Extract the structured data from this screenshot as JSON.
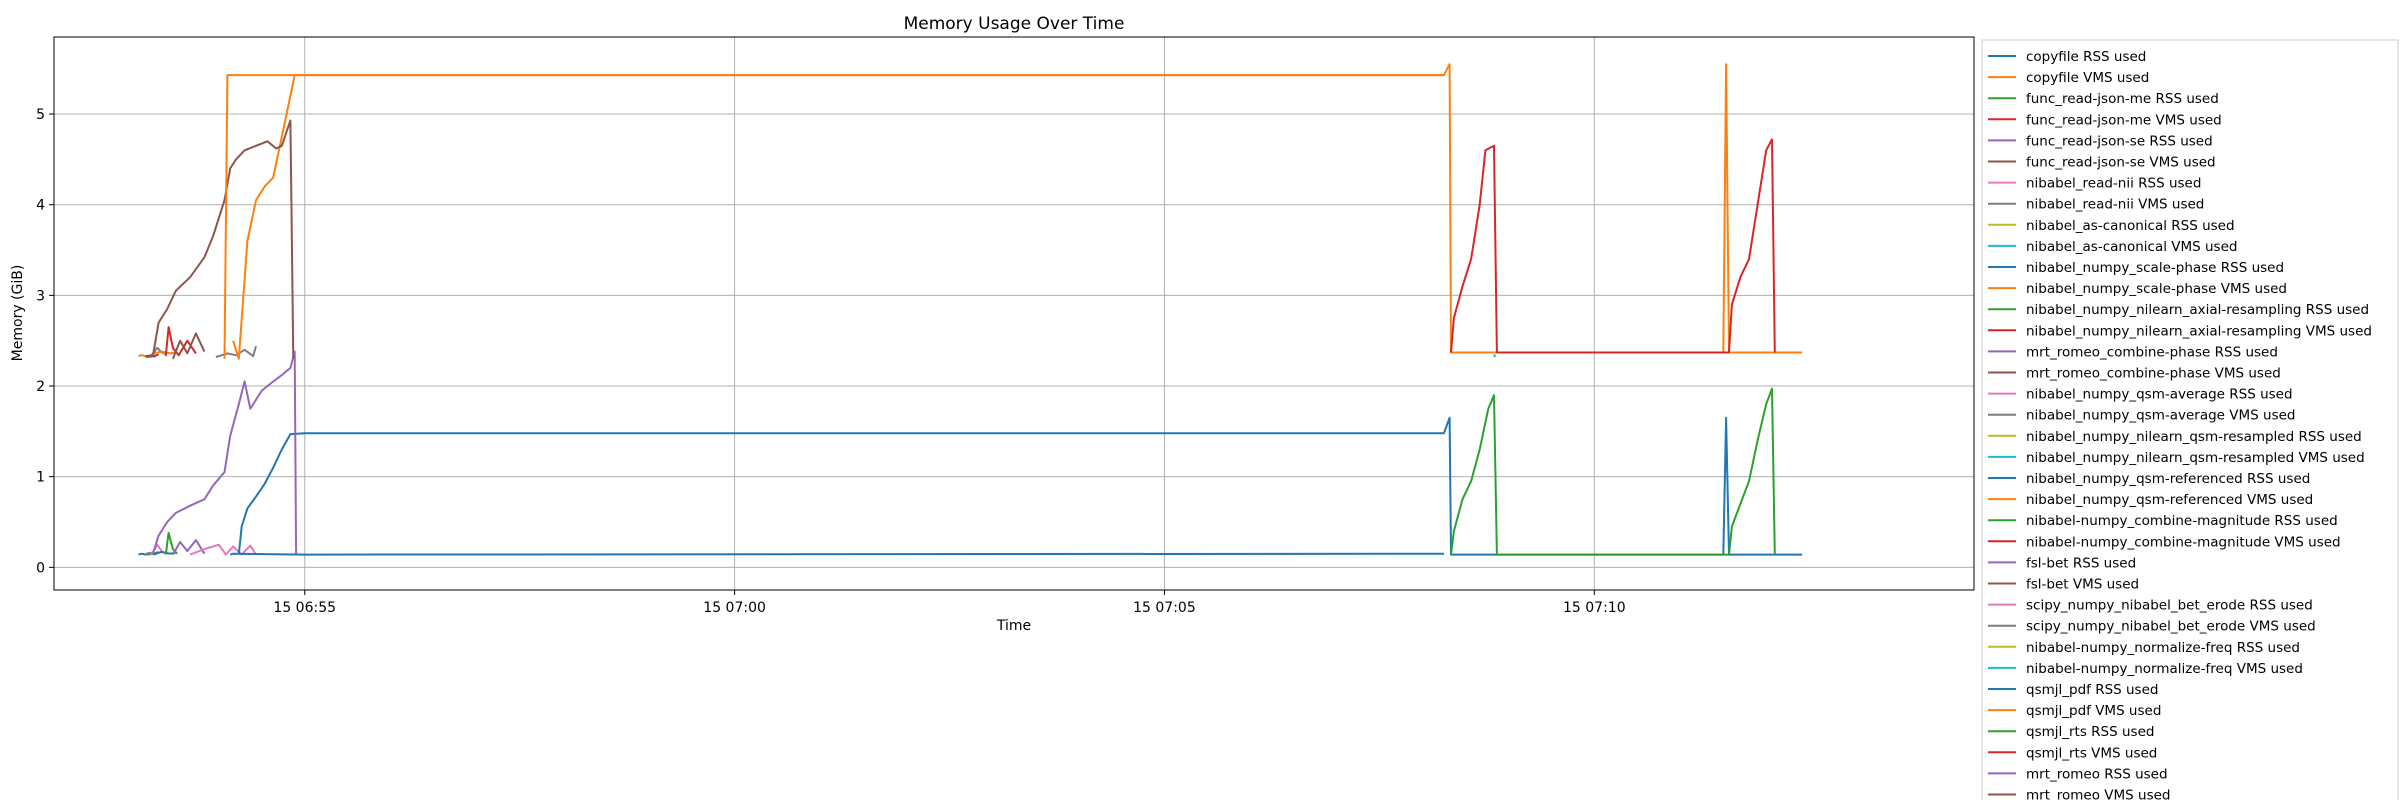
{
  "chart_data": {
    "type": "line",
    "title": "Memory Usage Over Time",
    "xlabel": "Time",
    "ylabel": "Memory (GiB)",
    "grid": true,
    "legend_position": "outside-right",
    "x_unit": "HH:MM:SS on the 15th",
    "xlim": [
      "06:52:05",
      "07:14:25"
    ],
    "ylim": [
      -0.25,
      5.85
    ],
    "xticks": [
      {
        "label": "15 06:55",
        "value": "06:55:00"
      },
      {
        "label": "15 07:00",
        "value": "07:00:00"
      },
      {
        "label": "15 07:05",
        "value": "07:05:00"
      },
      {
        "label": "15 07:10",
        "value": "07:10:00"
      }
    ],
    "yticks": [
      {
        "label": "0",
        "value": 0
      },
      {
        "label": "1",
        "value": 1
      },
      {
        "label": "2",
        "value": 2
      },
      {
        "label": "3",
        "value": 3
      },
      {
        "label": "4",
        "value": 4
      },
      {
        "label": "5",
        "value": 5
      }
    ],
    "series": [
      {
        "name": "copyfile RSS used",
        "color": "#1f77b4",
        "points": [
          [
            "06:53:04",
            0.14
          ],
          [
            "06:53:06",
            0.15
          ],
          [
            "06:53:09",
            0.14
          ]
        ]
      },
      {
        "name": "copyfile VMS used",
        "color": "#ff7f0e",
        "points": [
          [
            "06:53:04",
            2.33
          ],
          [
            "06:53:06",
            2.34
          ],
          [
            "06:53:09",
            2.33
          ]
        ]
      },
      {
        "name": "func_read-json-me RSS used",
        "color": "#2ca02c",
        "points": [
          [
            "06:53:09",
            0.14
          ],
          [
            "06:53:15",
            0.15
          ],
          [
            "06:53:18",
            0.17
          ]
        ]
      },
      {
        "name": "func_read-json-me VMS used",
        "color": "#d62728",
        "points": [
          [
            "06:53:09",
            2.32
          ],
          [
            "06:53:15",
            2.33
          ],
          [
            "06:53:18",
            2.35
          ]
        ]
      },
      {
        "name": "func_read-json-se RSS used",
        "color": "#9467bd",
        "points": [
          [
            "06:53:09",
            0.15
          ],
          [
            "06:53:13",
            0.16
          ],
          [
            "06:53:16",
            0.14
          ]
        ]
      },
      {
        "name": "func_read-json-se VMS used",
        "color": "#8c564b",
        "points": [
          [
            "06:53:09",
            2.33
          ],
          [
            "06:53:13",
            2.34
          ],
          [
            "06:53:16",
            2.32
          ]
        ]
      },
      {
        "name": "nibabel_read-nii RSS used",
        "color": "#e377c2",
        "points": [
          [
            "06:53:13",
            0.14
          ],
          [
            "06:53:17",
            0.25
          ],
          [
            "06:53:21",
            0.16
          ]
        ]
      },
      {
        "name": "nibabel_read-nii VMS used",
        "color": "#7f7f7f",
        "points": [
          [
            "06:53:13",
            2.34
          ],
          [
            "06:53:17",
            2.42
          ],
          [
            "06:53:21",
            2.36
          ]
        ]
      },
      {
        "name": "nibabel_as-canonical RSS used",
        "color": "#bcbd22",
        "points": [
          [
            "06:53:21",
            0.16
          ],
          [
            "06:53:24",
            0.16
          ]
        ]
      },
      {
        "name": "nibabel_as-canonical VMS used",
        "color": "#17becf",
        "points": [
          [
            "06:53:21",
            2.36
          ],
          [
            "06:53:24",
            2.36
          ]
        ]
      },
      {
        "name": "nibabel_numpy_scale-phase RSS used",
        "color": "#1f77b4",
        "points": [
          [
            "06:53:14",
            0.14
          ],
          [
            "06:53:20",
            0.17
          ],
          [
            "06:53:26",
            0.15
          ],
          [
            "06:53:30",
            0.16
          ]
        ]
      },
      {
        "name": "nibabel_numpy_scale-phase VMS used",
        "color": "#ff7f0e",
        "points": [
          [
            "06:53:14",
            2.36
          ],
          [
            "06:53:20",
            2.38
          ],
          [
            "06:53:26",
            2.36
          ],
          [
            "06:53:30",
            2.37
          ]
        ]
      },
      {
        "name": "nibabel_numpy_nilearn_axial-resampling RSS used",
        "color": "#2ca02c",
        "points": [
          [
            "06:53:23",
            0.14
          ],
          [
            "06:53:25",
            0.38
          ],
          [
            "06:53:28",
            0.2
          ],
          [
            "06:53:31",
            0.15
          ]
        ]
      },
      {
        "name": "nibabel_numpy_nilearn_axial-resampling VMS used",
        "color": "#d62728",
        "points": [
          [
            "06:53:23",
            2.33
          ],
          [
            "06:53:25",
            2.65
          ],
          [
            "06:53:28",
            2.42
          ],
          [
            "06:53:32",
            2.34
          ],
          [
            "06:53:38",
            2.5
          ],
          [
            "06:53:44",
            2.36
          ]
        ]
      },
      {
        "name": "mrt_romeo_combine-phase RSS used",
        "color": "#9467bd",
        "points": [
          [
            "06:53:28",
            0.14
          ],
          [
            "06:53:33",
            0.28
          ],
          [
            "06:53:38",
            0.18
          ],
          [
            "06:53:44",
            0.3
          ],
          [
            "06:53:50",
            0.15
          ]
        ]
      },
      {
        "name": "mrt_romeo_combine-phase VMS used",
        "color": "#8c564b",
        "points": [
          [
            "06:53:28",
            2.3
          ],
          [
            "06:53:33",
            2.5
          ],
          [
            "06:53:38",
            2.36
          ],
          [
            "06:53:44",
            2.58
          ],
          [
            "06:53:50",
            2.38
          ]
        ]
      },
      {
        "name": "nibabel_numpy_qsm-average RSS used",
        "color": "#e377c2",
        "points": [
          [
            "06:53:40",
            0.14
          ],
          [
            "06:53:50",
            0.2
          ],
          [
            "06:54:00",
            0.25
          ],
          [
            "06:54:05",
            0.14
          ],
          [
            "06:54:10",
            0.23
          ],
          [
            "06:54:16",
            0.14
          ],
          [
            "06:54:22",
            0.24
          ],
          [
            "06:54:26",
            0.14
          ]
        ]
      },
      {
        "name": "nibabel_numpy_qsm-average VMS used",
        "color": "#7f7f7f",
        "points": [
          [
            "06:53:58",
            2.32
          ],
          [
            "06:54:06",
            2.36
          ],
          [
            "06:54:12",
            2.34
          ],
          [
            "06:54:18",
            2.4
          ],
          [
            "06:54:24",
            2.33
          ],
          [
            "06:54:26",
            2.44
          ]
        ]
      },
      {
        "name": "nibabel_numpy_nilearn_qsm-resampled RSS used",
        "color": "#bcbd22",
        "points": []
      },
      {
        "name": "nibabel_numpy_nilearn_qsm-resampled VMS used",
        "color": "#17becf",
        "points": []
      },
      {
        "name": "nibabel_numpy_qsm-referenced RSS used",
        "color": "#1f77b4",
        "points": [
          [
            "06:54:14",
            0.14
          ],
          [
            "06:54:16",
            0.45
          ],
          [
            "06:54:20",
            0.65
          ],
          [
            "06:54:26",
            0.78
          ],
          [
            "06:54:32",
            0.92
          ],
          [
            "06:54:38",
            1.1
          ],
          [
            "06:54:44",
            1.3
          ],
          [
            "06:54:50",
            1.47
          ],
          [
            "06:55:00",
            1.48
          ],
          [
            "07:08:15",
            1.48
          ],
          [
            "07:08:19",
            1.65
          ],
          [
            "07:08:20",
            0.14
          ],
          [
            "07:11:30",
            0.14
          ],
          [
            "07:11:32",
            1.65
          ],
          [
            "07:11:34",
            0.14
          ],
          [
            "07:12:25",
            0.14
          ]
        ]
      },
      {
        "name": "nibabel_numpy_qsm-referenced VMS used",
        "color": "#ff7f0e",
        "points": [
          [
            "06:54:10",
            2.5
          ],
          [
            "06:54:14",
            2.3
          ],
          [
            "06:54:20",
            3.6
          ],
          [
            "06:54:26",
            4.05
          ],
          [
            "06:54:32",
            4.2
          ],
          [
            "06:54:38",
            4.3
          ],
          [
            "06:54:44",
            4.75
          ],
          [
            "06:54:50",
            5.2
          ],
          [
            "06:54:53",
            5.43
          ],
          [
            "07:08:15",
            5.43
          ],
          [
            "07:08:19",
            5.55
          ],
          [
            "07:08:20",
            2.37
          ],
          [
            "07:11:30",
            2.37
          ],
          [
            "07:11:32",
            5.55
          ],
          [
            "07:11:34",
            2.37
          ],
          [
            "07:12:25",
            2.37
          ]
        ]
      },
      {
        "name": "nibabel-numpy_combine-magnitude RSS used",
        "color": "#2ca02c",
        "points": [
          [
            "07:08:20",
            0.14
          ],
          [
            "07:08:22",
            0.4
          ],
          [
            "07:08:28",
            0.75
          ],
          [
            "07:08:34",
            0.95
          ],
          [
            "07:08:40",
            1.3
          ],
          [
            "07:08:46",
            1.75
          ],
          [
            "07:08:50",
            1.9
          ],
          [
            "07:08:52",
            0.14
          ],
          [
            "07:11:34",
            0.14
          ],
          [
            "07:11:36",
            0.45
          ],
          [
            "07:11:42",
            0.7
          ],
          [
            "07:11:48",
            0.95
          ],
          [
            "07:11:54",
            1.4
          ],
          [
            "07:12:00",
            1.8
          ],
          [
            "07:12:04",
            1.97
          ],
          [
            "07:12:06",
            0.14
          ]
        ]
      },
      {
        "name": "nibabel-numpy_combine-magnitude VMS used",
        "color": "#d62728",
        "points": [
          [
            "07:08:20",
            2.37
          ],
          [
            "07:08:22",
            2.75
          ],
          [
            "07:08:28",
            3.1
          ],
          [
            "07:08:34",
            3.4
          ],
          [
            "07:08:40",
            4.0
          ],
          [
            "07:08:44",
            4.6
          ],
          [
            "07:08:50",
            4.65
          ],
          [
            "07:08:52",
            2.37
          ],
          [
            "07:11:34",
            2.37
          ],
          [
            "07:11:36",
            2.9
          ],
          [
            "07:11:42",
            3.2
          ],
          [
            "07:11:48",
            3.4
          ],
          [
            "07:11:54",
            4.0
          ],
          [
            "07:12:00",
            4.6
          ],
          [
            "07:12:04",
            4.72
          ],
          [
            "07:12:06",
            2.37
          ]
        ]
      },
      {
        "name": "fsl-bet RSS used",
        "color": "#9467bd",
        "points": [
          [
            "06:53:14",
            0.15
          ],
          [
            "06:53:18",
            0.35
          ],
          [
            "06:53:24",
            0.5
          ],
          [
            "06:53:30",
            0.6
          ],
          [
            "06:53:40",
            0.68
          ],
          [
            "06:53:50",
            0.75
          ],
          [
            "06:53:56",
            0.9
          ],
          [
            "06:54:04",
            1.05
          ],
          [
            "06:54:08",
            1.45
          ],
          [
            "06:54:14",
            1.8
          ],
          [
            "06:54:18",
            2.05
          ],
          [
            "06:54:22",
            1.75
          ],
          [
            "06:54:30",
            1.95
          ],
          [
            "06:54:38",
            2.05
          ],
          [
            "06:54:44",
            2.12
          ],
          [
            "06:54:50",
            2.2
          ],
          [
            "06:54:53",
            2.38
          ],
          [
            "06:54:54",
            0.14
          ]
        ]
      },
      {
        "name": "fsl-bet VMS used",
        "color": "#8c564b",
        "points": [
          [
            "06:53:14",
            2.33
          ],
          [
            "06:53:18",
            2.7
          ],
          [
            "06:53:24",
            2.85
          ],
          [
            "06:53:30",
            3.05
          ],
          [
            "06:53:40",
            3.2
          ],
          [
            "06:53:50",
            3.42
          ],
          [
            "06:53:56",
            3.65
          ],
          [
            "06:54:04",
            4.05
          ],
          [
            "06:54:08",
            4.4
          ],
          [
            "06:54:12",
            4.5
          ],
          [
            "06:54:18",
            4.6
          ],
          [
            "06:54:26",
            4.65
          ],
          [
            "06:54:34",
            4.7
          ],
          [
            "06:54:40",
            4.62
          ],
          [
            "06:54:44",
            4.65
          ],
          [
            "06:54:50",
            4.93
          ],
          [
            "06:54:52",
            2.3
          ]
        ]
      },
      {
        "name": "scipy_numpy_nibabel_bet_erode RSS used",
        "color": "#e377c2",
        "points": []
      },
      {
        "name": "scipy_numpy_nibabel_bet_erode VMS used",
        "color": "#7f7f7f",
        "points": []
      },
      {
        "name": "nibabel-numpy_normalize-freq RSS used",
        "color": "#bcbd22",
        "points": []
      },
      {
        "name": "nibabel-numpy_normalize-freq VMS used",
        "color": "#17becf",
        "points": [
          [
            "07:08:50",
            2.35
          ],
          [
            "07:08:51",
            2.32
          ]
        ]
      },
      {
        "name": "qsmjl_pdf RSS used",
        "color": "#1f77b4",
        "points": [
          [
            "06:54:08",
            0.14
          ],
          [
            "06:54:10",
            0.15
          ],
          [
            "06:55:00",
            0.14
          ],
          [
            "07:08:15",
            0.15
          ]
        ]
      },
      {
        "name": "qsmjl_pdf VMS used",
        "color": "#ff7f0e",
        "points": [
          [
            "06:54:04",
            2.3
          ],
          [
            "06:54:06",
            5.43
          ],
          [
            "06:55:00",
            5.43
          ],
          [
            "06:58:00",
            5.43
          ],
          [
            "07:02:00",
            5.43
          ],
          [
            "07:06:00",
            5.43
          ],
          [
            "07:08:15",
            5.43
          ]
        ]
      },
      {
        "name": "qsmjl_rts RSS used",
        "color": "#2ca02c",
        "points": []
      },
      {
        "name": "qsmjl_rts VMS used",
        "color": "#d62728",
        "points": []
      },
      {
        "name": "mrt_romeo RSS used",
        "color": "#9467bd",
        "points": []
      },
      {
        "name": "mrt_romeo VMS used",
        "color": "#8c564b",
        "points": []
      }
    ]
  }
}
